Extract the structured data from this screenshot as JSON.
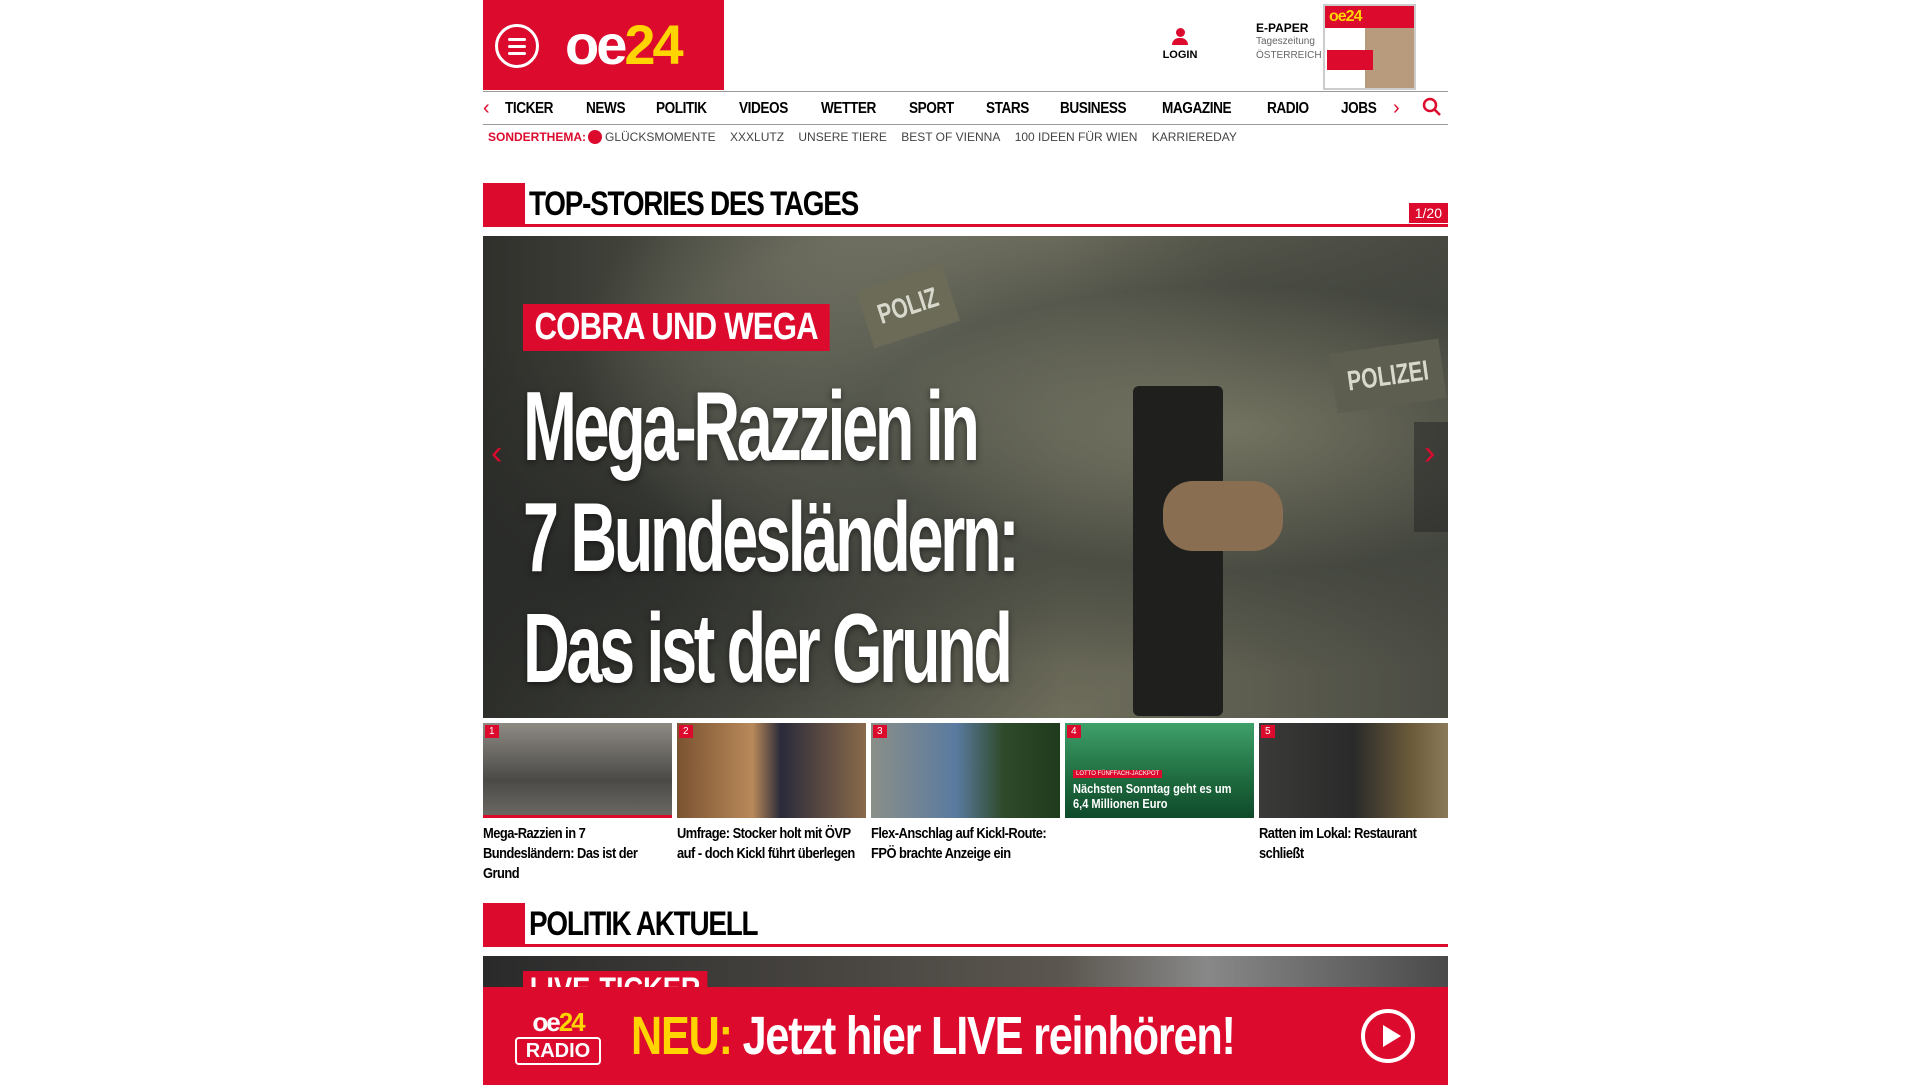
{
  "header": {
    "logo_text_a": "oe",
    "logo_text_b": "24",
    "login_label": "LOGIN",
    "epaper": {
      "title": "E-PAPER",
      "line1": "Tageszeitung",
      "line2": "ÖSTERREICH"
    }
  },
  "nav": {
    "items": [
      "TICKER",
      "NEWS",
      "POLITIK",
      "VIDEOS",
      "WETTER",
      "SPORT",
      "STARS",
      "BUSINESS",
      "MAGAZINE",
      "RADIO",
      "JOBS"
    ]
  },
  "subnav": {
    "label": "SONDERTHEMA:",
    "items": [
      "GLÜCKSMOMENTE",
      "XXXLUTZ",
      "UNSERE TIERE",
      "BEST OF VIENNA",
      "100 IDEEN FÜR WIEN",
      "KARRIEREDAY"
    ]
  },
  "top_stories": {
    "title": "TOP-STORIES DES TAGES",
    "counter": "1/20",
    "hero": {
      "kicker": "COBRA UND WEGA",
      "headline_lines": [
        "Mega-Razzien in",
        "7 Bundesländern:",
        "Das ist der Grund"
      ],
      "photo_text_1": "POLIZ",
      "photo_text_2": "POLIZEI"
    },
    "thumbs": [
      {
        "num": "1",
        "caption": "Mega-Razzien in 7 Bundesländern: Das ist der Grund"
      },
      {
        "num": "2",
        "caption": "Umfrage: Stocker holt mit ÖVP auf - doch Kickl führt überlegen"
      },
      {
        "num": "3",
        "caption": "Flex-Anschlag auf Kickl-Route: FPÖ brachte Anzeige ein"
      },
      {
        "num": "4",
        "caption": "",
        "overlay_tag": "LOTTO FÜNFFACH-JACKPOT",
        "overlay": "Nächsten Sonntag geht es um 6,4 Millionen Euro"
      },
      {
        "num": "5",
        "caption": "Ratten im Lokal: Restaurant schließt"
      }
    ]
  },
  "politik": {
    "title": "POLITIK AKTUELL",
    "peek_label": "LIVE-TICKER"
  },
  "radio_banner": {
    "logo_a": "oe",
    "logo_b": "24",
    "logo_radio": "RADIO",
    "neu": "NEU:",
    "message": " Jetzt hier LIVE reinhören!"
  },
  "colors": {
    "brand_red": "#dc0a2d",
    "brand_yellow": "#ffd400"
  }
}
